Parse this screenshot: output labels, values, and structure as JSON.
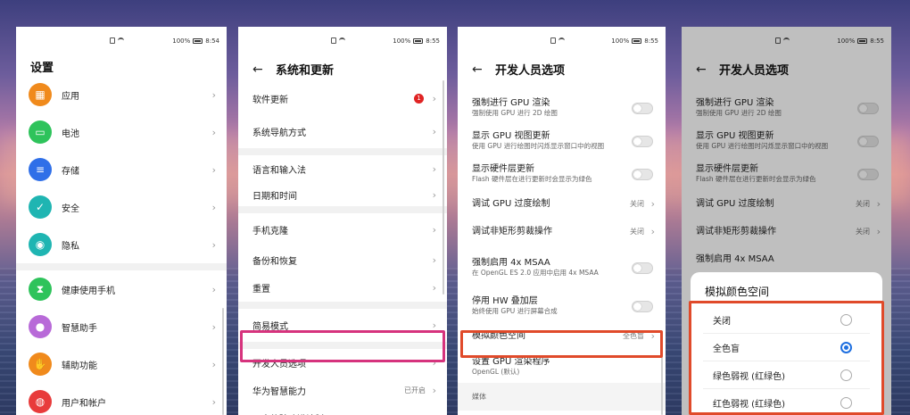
{
  "status": [
    {
      "time": "8:54",
      "battery": "100%"
    },
    {
      "time": "8:55",
      "battery": "100%"
    },
    {
      "time": "8:55",
      "battery": "100%"
    },
    {
      "time": "8:55",
      "battery": "100%"
    }
  ],
  "panel1": {
    "title": "设置",
    "items": [
      {
        "label": "应用",
        "icon": "apps-icon",
        "color": "#f08a1c"
      },
      {
        "label": "电池",
        "icon": "battery-icon",
        "color": "#2ec35b"
      },
      {
        "label": "存储",
        "icon": "storage-icon",
        "color": "#2f6fe8"
      },
      {
        "label": "安全",
        "icon": "shield-icon",
        "color": "#1fb5b2"
      },
      {
        "label": "隐私",
        "icon": "privacy-icon",
        "color": "#1fb5b2"
      },
      {
        "label": "健康使用手机",
        "icon": "hourglass-icon",
        "color": "#2ec35b"
      },
      {
        "label": "智慧助手",
        "icon": "assistant-icon",
        "color": "#b86ad8"
      },
      {
        "label": "辅助功能",
        "icon": "hand-icon",
        "color": "#f08a1c"
      },
      {
        "label": "用户和帐户",
        "icon": "user-icon",
        "color": "#e83b3b"
      }
    ]
  },
  "panel2": {
    "title": "系统和更新",
    "items": [
      {
        "label": "软件更新",
        "badge": "1"
      },
      {
        "label": "系统导航方式"
      },
      {
        "label": "语言和输入法"
      },
      {
        "label": "日期和时间"
      },
      {
        "label": "手机克隆"
      },
      {
        "label": "备份和恢复"
      },
      {
        "label": "重置"
      },
      {
        "label": "简易模式"
      },
      {
        "label": "开发人员选项"
      },
      {
        "label": "华为智慧能力",
        "value": "已开启"
      },
      {
        "label": "用户体验改进计划"
      }
    ]
  },
  "panel3": {
    "title": "开发人员选项",
    "items": [
      {
        "label": "强制进行 GPU 渲染",
        "sub": "强制使用 GPU 进行 2D 绘图"
      },
      {
        "label": "显示 GPU 视图更新",
        "sub": "使用 GPU 进行绘图时闪烁显示窗口中的视图"
      },
      {
        "label": "显示硬件层更新",
        "sub": "Flash 硬件层在进行更新时会显示为绿色"
      },
      {
        "label": "调试 GPU 过度绘制",
        "value": "关闭"
      },
      {
        "label": "调试非矩形剪裁操作",
        "value": "关闭"
      },
      {
        "label": "强制启用 4x MSAA",
        "sub": "在 OpenGL ES 2.0 应用中启用 4x MSAA"
      },
      {
        "label": "停用 HW 叠加层",
        "sub": "始终使用 GPU 进行屏幕合成"
      },
      {
        "label": "模拟颜色空间",
        "value": "全色盲"
      },
      {
        "label": "设置 GPU 渲染程序",
        "sub": "OpenGL (默认)"
      },
      {
        "label": "媒体"
      }
    ]
  },
  "panel4": {
    "title": "开发人员选项",
    "items": [
      {
        "label": "强制进行 GPU 渲染",
        "sub": "强制使用 GPU 进行 2D 绘图"
      },
      {
        "label": "显示 GPU 视图更新",
        "sub": "使用 GPU 进行绘图时闪烁显示窗口中的视图"
      },
      {
        "label": "显示硬件层更新",
        "sub": "Flash 硬件层在进行更新时会显示为绿色"
      },
      {
        "label": "调试 GPU 过度绘制",
        "value": "关闭"
      },
      {
        "label": "调试非矩形剪裁操作",
        "value": "关闭"
      },
      {
        "label": "强制启用 4x MSAA"
      }
    ],
    "dialog": {
      "title": "模拟颜色空间",
      "options": [
        "关闭",
        "全色盲",
        "绿色弱视 (红绿色)",
        "红色弱视 (红绿色)"
      ],
      "selected": 1
    }
  }
}
